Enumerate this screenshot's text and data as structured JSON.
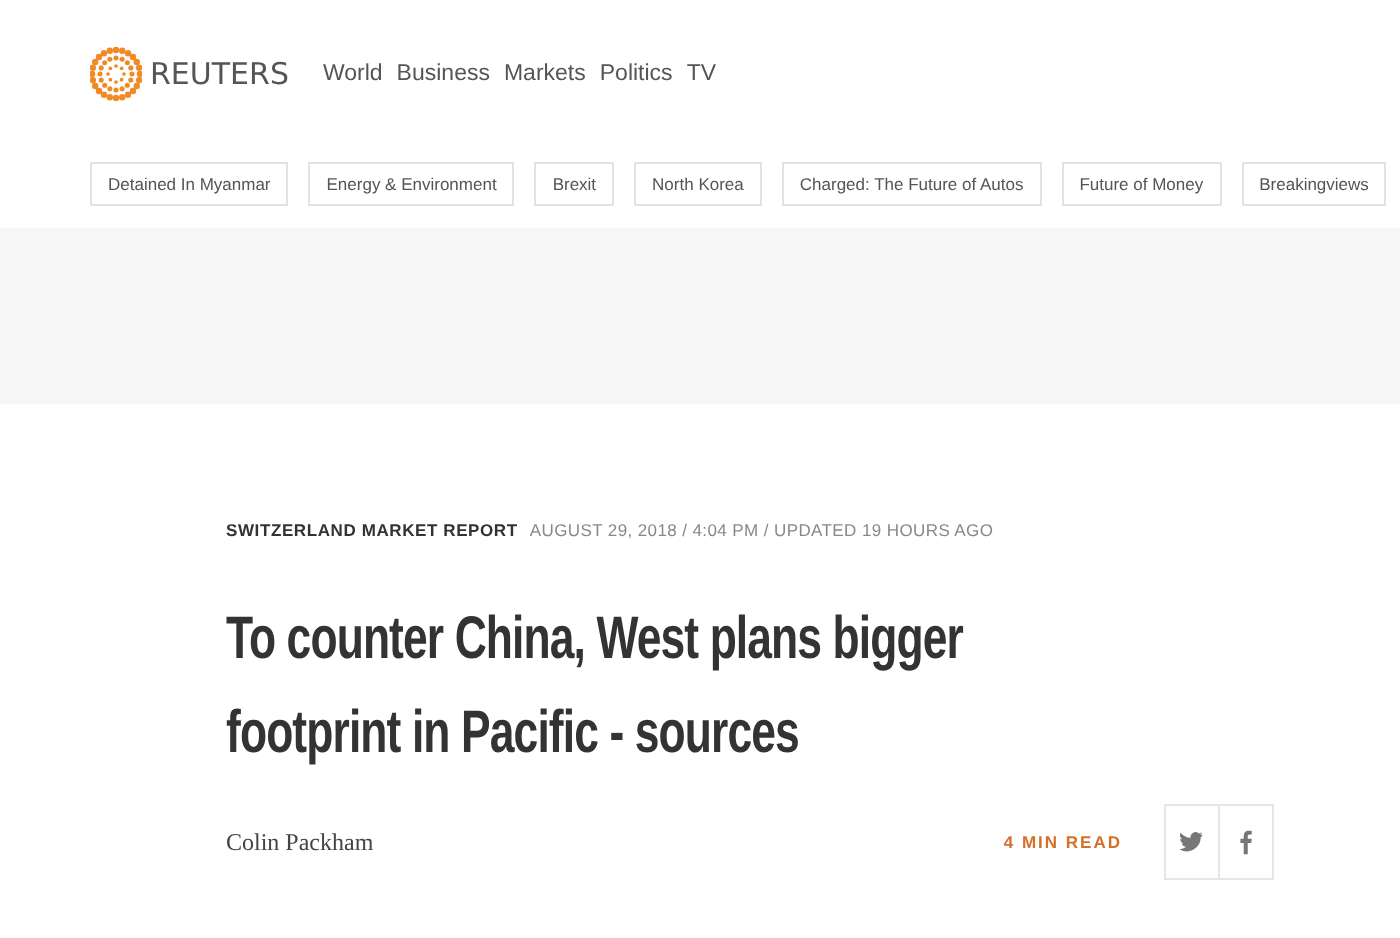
{
  "header": {
    "brand": "REUTERS",
    "nav": [
      {
        "label": "World"
      },
      {
        "label": "Business"
      },
      {
        "label": "Markets"
      },
      {
        "label": "Politics"
      },
      {
        "label": "TV"
      }
    ]
  },
  "topics": [
    {
      "label": "Detained In Myanmar"
    },
    {
      "label": "Energy & Environment"
    },
    {
      "label": "Brexit"
    },
    {
      "label": "North Korea"
    },
    {
      "label": "Charged: The Future of Autos"
    },
    {
      "label": "Future of Money"
    },
    {
      "label": "Breakingviews"
    }
  ],
  "article": {
    "section": "SWITZERLAND MARKET REPORT",
    "dateline": "AUGUST 29, 2018 / 4:04 PM / UPDATED 19 HOURS AGO",
    "headline": "To counter China, West plans bigger footprint in Pacific - sources",
    "author": "Colin Packham",
    "read_time": "4 MIN READ",
    "share": [
      {
        "kind": "twitter"
      },
      {
        "kind": "facebook"
      }
    ]
  }
}
